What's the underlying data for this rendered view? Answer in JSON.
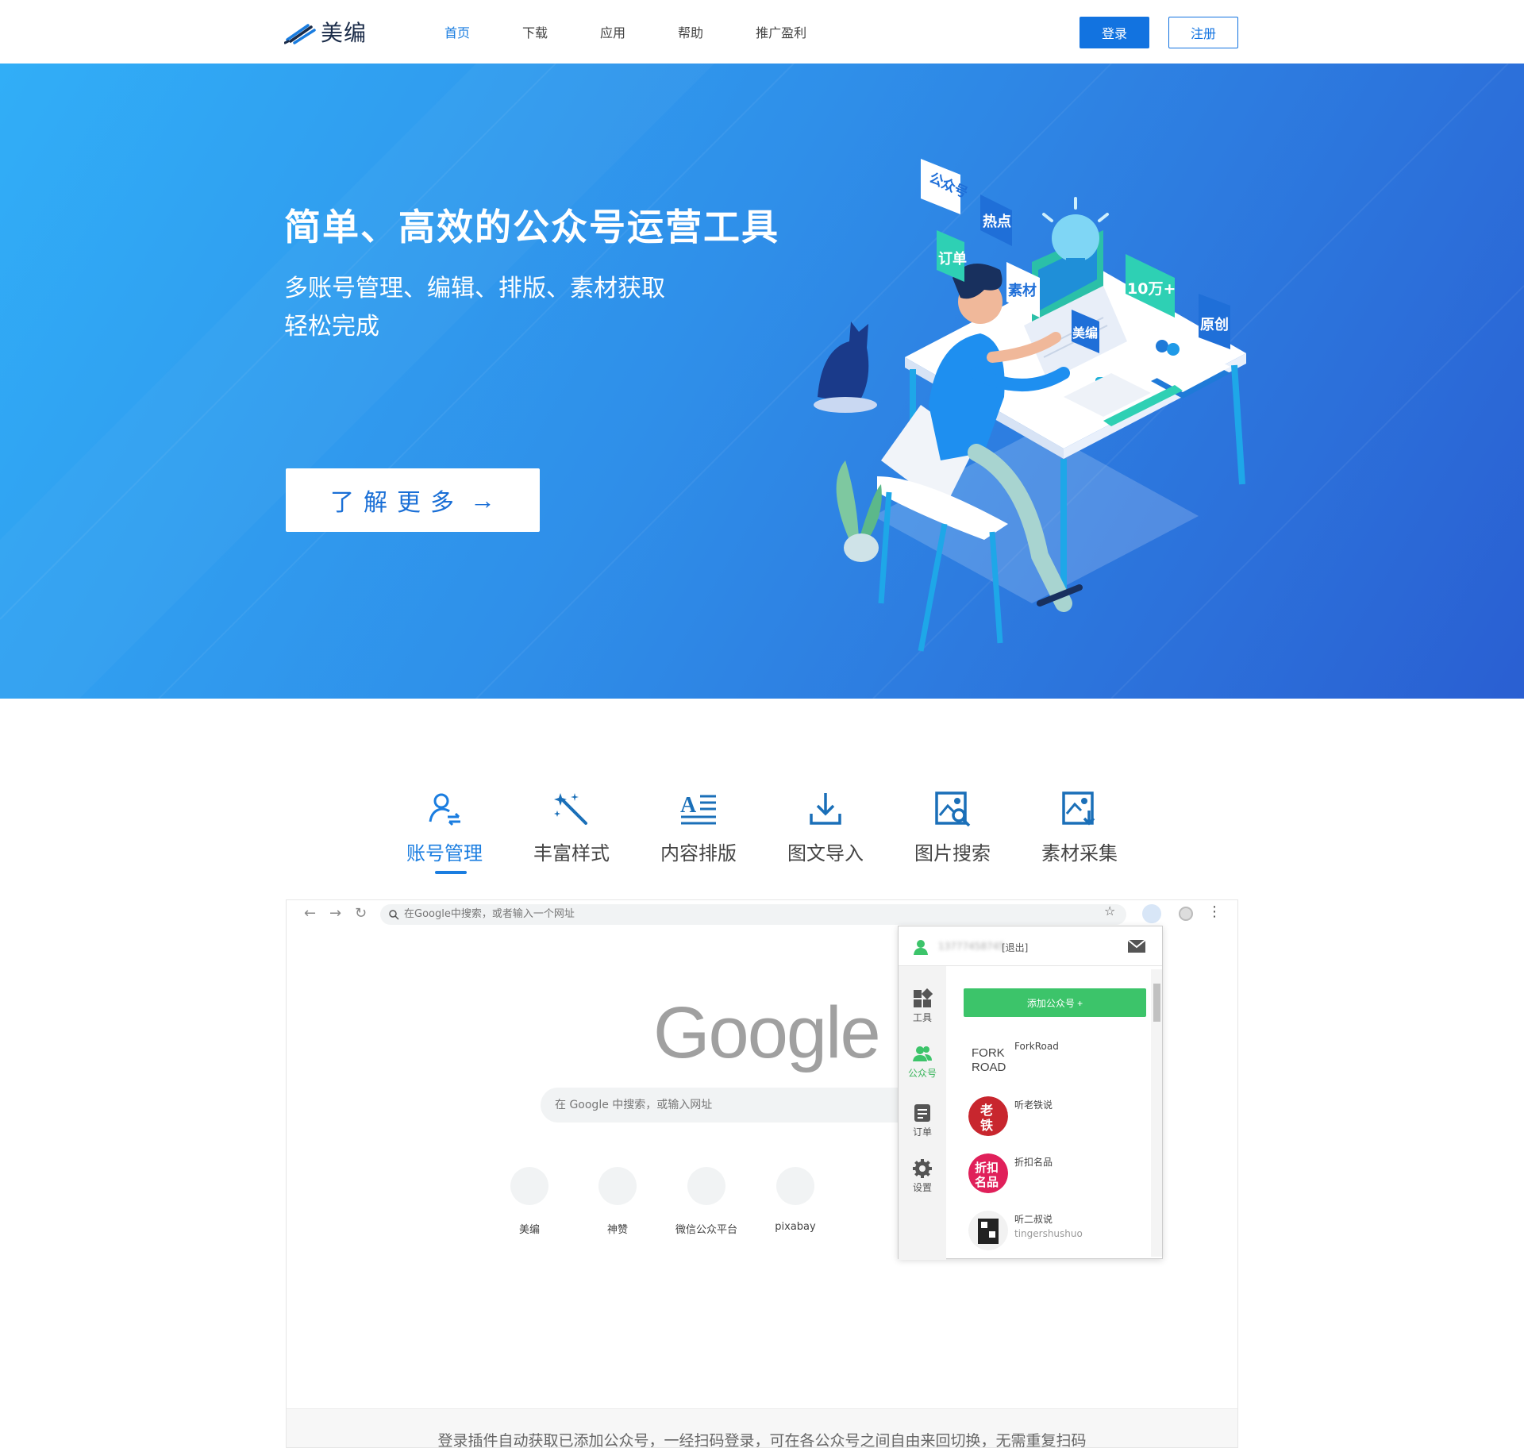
{
  "header": {
    "logo_text": "美编",
    "nav": [
      "首页",
      "下载",
      "应用",
      "帮助",
      "推广盈利"
    ],
    "active_nav": "首页",
    "login_label": "登录",
    "register_label": "注册"
  },
  "hero": {
    "title": "简单、高效的公众号运营工具",
    "subtitle_line1": "多账号管理、编辑、排版、素材获取",
    "subtitle_line2": "轻松完成",
    "cta_label": "了解更多",
    "cta_arrow": "→",
    "illustration_tags": [
      "公众号",
      "热点",
      "订单",
      "素材",
      "美编",
      "10万+",
      "原创"
    ]
  },
  "features": {
    "active": "账号管理",
    "items": [
      {
        "label": "账号管理",
        "icon": "user-switch-icon"
      },
      {
        "label": "丰富样式",
        "icon": "magic-wand-icon"
      },
      {
        "label": "内容排版",
        "icon": "text-align-icon"
      },
      {
        "label": "图文导入",
        "icon": "download-icon"
      },
      {
        "label": "图片搜索",
        "icon": "image-search-icon"
      },
      {
        "label": "素材采集",
        "icon": "image-collect-icon"
      }
    ]
  },
  "browser": {
    "url_placeholder": "在Google中搜索，或者输入一个网址",
    "google_logo": "Google",
    "search_placeholder": "在 Google 中搜索，或输入网址",
    "shortcuts": [
      "美编",
      "神赞",
      "微信公众平台",
      "pixabay"
    ],
    "popup": {
      "phone": "13777458745",
      "logout": "[退出]",
      "sidebar": [
        {
          "label": "工具",
          "icon": "grid-icon"
        },
        {
          "label": "公众号",
          "icon": "users-icon"
        },
        {
          "label": "订单",
          "icon": "document-icon"
        },
        {
          "label": "设置",
          "icon": "gear-icon"
        }
      ],
      "active_sidebar": "公众号",
      "add_button": "添加公众号 +",
      "accounts": [
        {
          "name": "ForkRoad",
          "sub": "",
          "avatar_text": "FORK ROAD"
        },
        {
          "name": "听老铁说",
          "sub": "",
          "avatar_text": "老铁"
        },
        {
          "name": "折扣名品",
          "sub": "",
          "avatar_text": "折扣名品"
        },
        {
          "name": "听二叔说",
          "sub": "tingershushuo",
          "avatar_text": ""
        }
      ]
    },
    "caption": "登录插件自动获取已添加公众号，一经扫码登录，可在各公众号之间自由来回切换，无需重复扫码"
  },
  "colors": {
    "accent": "#1273e0",
    "hero_start": "#31aef7",
    "hero_end": "#2a5fd2",
    "green": "#3cc46a"
  }
}
